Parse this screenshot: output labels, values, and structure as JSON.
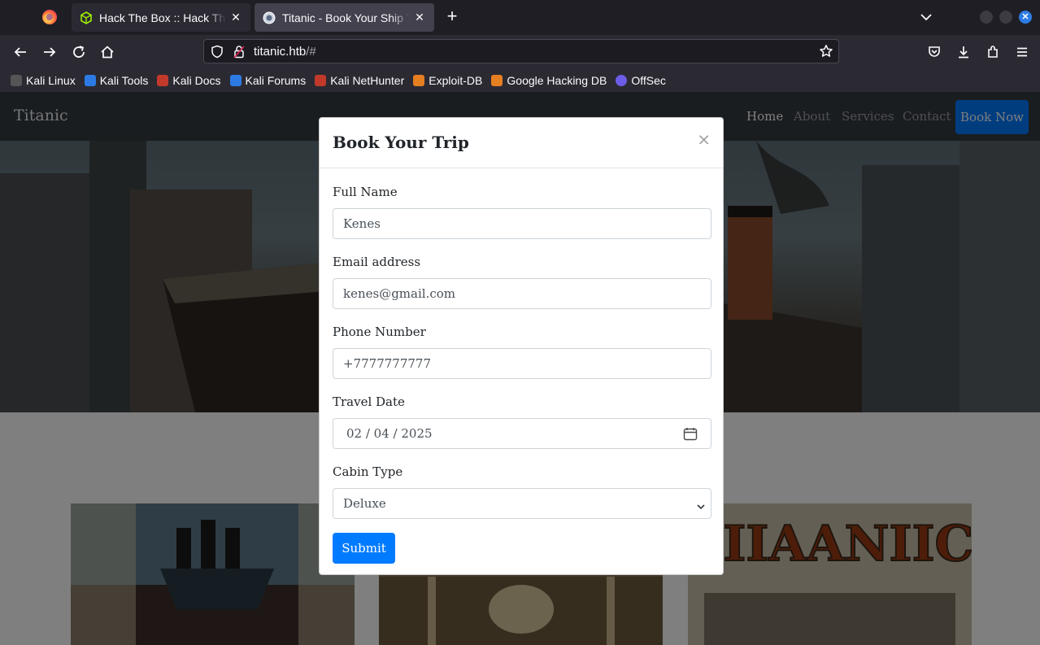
{
  "browser": {
    "tabs": [
      {
        "title": "Hack The Box :: Hack The Box",
        "active": false
      },
      {
        "title": "Titanic - Book Your Ship Trip",
        "active": true
      }
    ],
    "new_tab": "+",
    "url_host": "titanic.htb",
    "url_path": "/#",
    "bookmarks": [
      {
        "label": "Kali Linux",
        "color": "#444"
      },
      {
        "label": "Kali Tools",
        "color": "#2c7be5"
      },
      {
        "label": "Kali Docs",
        "color": "#c0392b"
      },
      {
        "label": "Kali Forums",
        "color": "#2c7be5"
      },
      {
        "label": "Kali NetHunter",
        "color": "#c0392b"
      },
      {
        "label": "Exploit-DB",
        "color": "#e67e22"
      },
      {
        "label": "Google Hacking DB",
        "color": "#e67e22"
      },
      {
        "label": "OffSec",
        "color": "#6c5ce7"
      }
    ]
  },
  "site": {
    "brand": "Titanic",
    "nav": {
      "home": "Home",
      "about": "About",
      "services": "Services",
      "contact": "Contact",
      "book": "Book Now"
    }
  },
  "modal": {
    "title": "Book Your Trip",
    "close": "×",
    "fields": {
      "name": {
        "label": "Full Name",
        "value": "Kenes"
      },
      "email": {
        "label": "Email address",
        "value": "kenes@gmail.com"
      },
      "phone": {
        "label": "Phone Number",
        "value": "+7777777777"
      },
      "date": {
        "label": "Travel Date",
        "value": "02 / 04 / 2025"
      },
      "cabin": {
        "label": "Cabin Type",
        "value": "Deluxe"
      }
    },
    "submit": "Submit"
  },
  "colors": {
    "accent": "#007bff",
    "navbar": "#343a40"
  }
}
